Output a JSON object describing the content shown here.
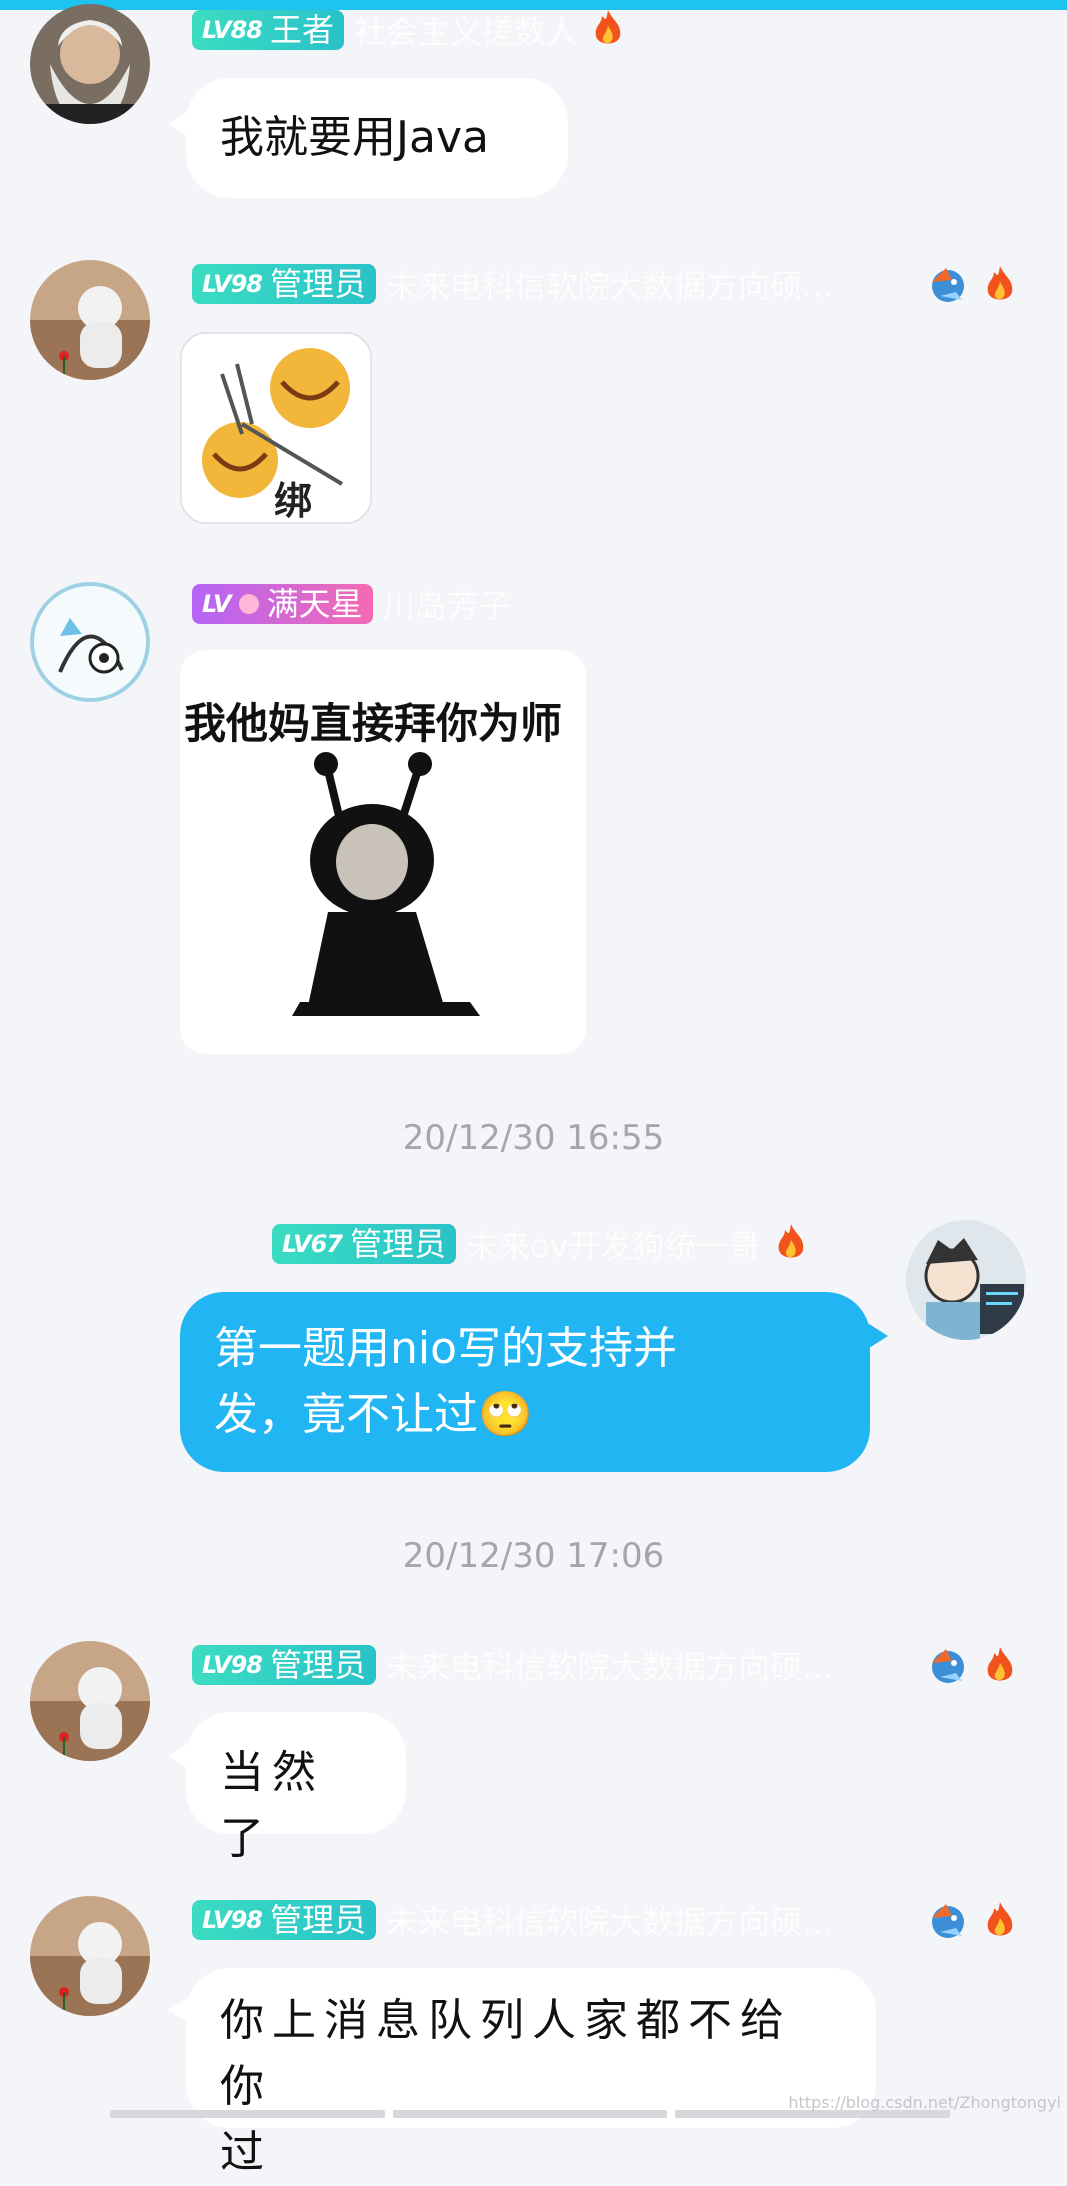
{
  "messages": [
    {
      "level": "LV88",
      "title": "王者",
      "nick": "社会主义搓数人",
      "text": "我就要用Java"
    },
    {
      "level": "LV98",
      "title": "管理员",
      "nick": "未来电科信软院大数据方向硕…",
      "sticker_caption": "绑"
    },
    {
      "level": "LV",
      "title": "满天星",
      "nick": "川岛芳子",
      "sticker_caption": "我他妈直接拜你为师"
    },
    {
      "level": "LV67",
      "title": "管理员",
      "nick": "未来ov开发狗统一哥",
      "text_line1": "第一题用nio写的支持并",
      "text_line2": "发，竟不让过🙄"
    },
    {
      "level": "LV98",
      "title": "管理员",
      "nick": "未来电科信软院大数据方向硕…",
      "text": "当然了"
    },
    {
      "level": "LV98",
      "title": "管理员",
      "nick": "未来电科信软院大数据方向硕…",
      "text_line1": "你上消息队列人家都不给你",
      "text_line2": "过"
    }
  ],
  "timestamps": [
    "20/12/30 16:55",
    "20/12/30 17:06"
  ],
  "watermark": "https://blog.csdn.net/Zhongtongyi",
  "colors": {
    "accent": "#1ec3f0",
    "bubble_blue": "#22b5f4",
    "badge_teal": "#2fcfc4"
  }
}
